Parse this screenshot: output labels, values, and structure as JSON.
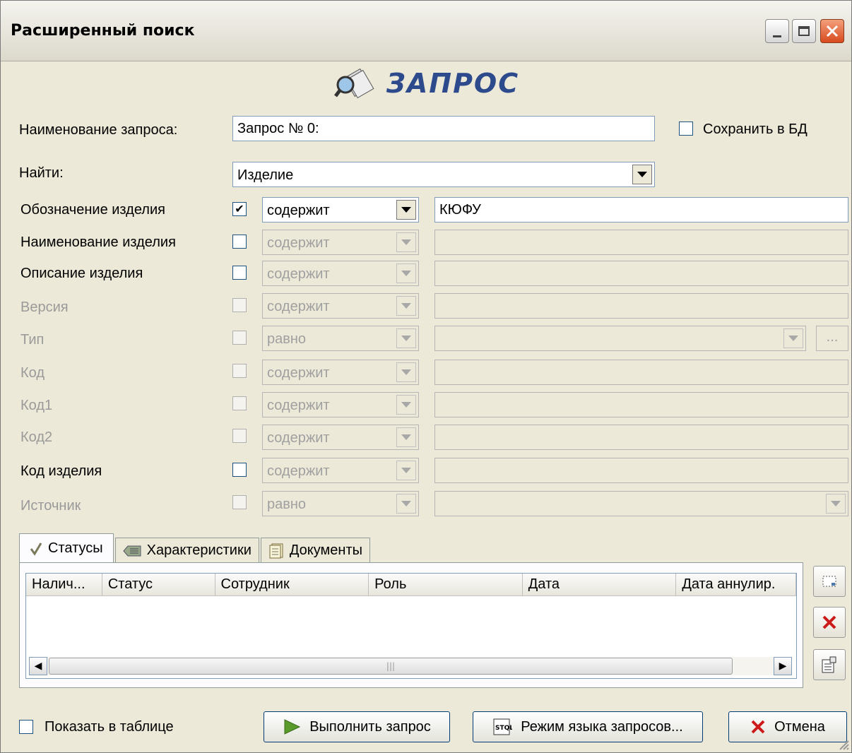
{
  "window": {
    "title": "Расширенный поиск",
    "header": "ЗАПРОС"
  },
  "query": {
    "name_label": "Наименование запроса:",
    "name_value": "Запрос № 0:",
    "save_label": "Сохранить в БД",
    "save_checked": false,
    "find_label": "Найти:",
    "find_value": "Изделие"
  },
  "criteria": [
    {
      "label": "Обозначение изделия",
      "enabled": true,
      "checked": true,
      "operator": "содержит",
      "value": "КЮФУ",
      "kind": "text"
    },
    {
      "label": "Наименование изделия",
      "enabled": true,
      "checked": false,
      "operator": "содержит",
      "value": "",
      "kind": "text"
    },
    {
      "label": "Описание изделия",
      "enabled": true,
      "checked": false,
      "operator": "содержит",
      "value": "",
      "kind": "text"
    },
    {
      "label": "Версия",
      "enabled": false,
      "checked": false,
      "operator": "содержит",
      "value": "",
      "kind": "text"
    },
    {
      "label": "Тип",
      "enabled": false,
      "checked": false,
      "operator": "равно",
      "value": "",
      "kind": "combo-browse",
      "browse_label": "..."
    },
    {
      "label": "Код",
      "enabled": false,
      "checked": false,
      "operator": "содержит",
      "value": "",
      "kind": "text"
    },
    {
      "label": "Код1",
      "enabled": false,
      "checked": false,
      "operator": "содержит",
      "value": "",
      "kind": "text"
    },
    {
      "label": "Код2",
      "enabled": false,
      "checked": false,
      "operator": "содержит",
      "value": "",
      "kind": "text"
    },
    {
      "label": "Код изделия",
      "enabled": true,
      "checked": false,
      "operator": "содержит",
      "value": "",
      "kind": "text"
    },
    {
      "label": "Источник",
      "enabled": false,
      "checked": false,
      "operator": "равно",
      "value": "",
      "kind": "combo"
    }
  ],
  "tabs": [
    {
      "label": "Статусы",
      "icon": "checkmark-icon",
      "active": true
    },
    {
      "label": "Характеристики",
      "icon": "tag-icon",
      "active": false
    },
    {
      "label": "Документы",
      "icon": "document-icon",
      "active": false
    }
  ],
  "status_table": {
    "columns": [
      "Налич...",
      "Статус",
      "Сотрудник",
      "Роль",
      "Дата",
      "Дата аннулир."
    ],
    "rows": []
  },
  "footer": {
    "show_in_table_label": "Показать в таблице",
    "show_in_table_checked": false,
    "run_label": "Выполнить запрос",
    "query_mode_label": "Режим языка запросов...",
    "cancel_label": "Отмена"
  },
  "colors": {
    "window_bg": "#ECE9D8",
    "header_text": "#2d4a8c",
    "cancel_icon": "#cc1a1a",
    "run_icon": "#4a8a1a"
  }
}
